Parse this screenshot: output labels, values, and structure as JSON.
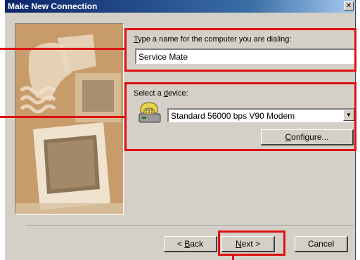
{
  "dialog": {
    "title": "Make New Connection"
  },
  "name_section": {
    "label_first": "T",
    "label_rest": "ype a name for the computer you are dialing:",
    "value": "Service Mate"
  },
  "device_section": {
    "label_prefix": "Select a ",
    "label_accel": "d",
    "label_rest": "evice:",
    "selected_device": "Standard 56000 bps V90 Modem",
    "configure_accel": "C",
    "configure_rest": "onfigure..."
  },
  "buttons": {
    "back_prefix": "< ",
    "back_accel": "B",
    "back_rest": "ack",
    "next_accel": "N",
    "next_rest": "ext >",
    "cancel": "Cancel"
  },
  "icons": {
    "close": "close-icon",
    "modem": "modem-phone-icon",
    "dropdown": "chevron-down-icon"
  },
  "colors": {
    "callout": "#e01010",
    "titlebar": "#0a246a"
  }
}
